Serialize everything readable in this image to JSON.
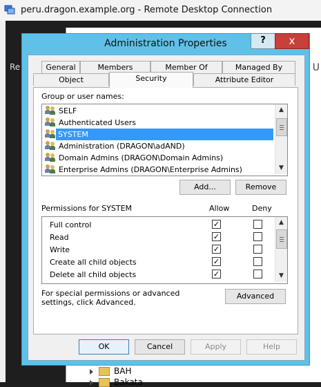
{
  "rdp": {
    "title": "peru.dragon.example.org - Remote Desktop Connection"
  },
  "background": {
    "left_text": "Re",
    "right_text": "y U",
    "tree_items": [
      "BAH",
      "Bakata"
    ]
  },
  "dialog": {
    "title": "Administration Properties",
    "help_label": "?",
    "close_label": "x",
    "tabs_row1": [
      "General",
      "Members",
      "Member Of",
      "Managed By"
    ],
    "tabs_row2": [
      "Object",
      "Security",
      "Attribute Editor"
    ],
    "active_tab": "Security",
    "group_label": "Group or user names:",
    "groups": [
      {
        "name": "SELF",
        "selected": false
      },
      {
        "name": "Authenticated Users",
        "selected": false
      },
      {
        "name": "SYSTEM",
        "selected": true
      },
      {
        "name": "Administration (DRAGON\\adAND)",
        "selected": false
      },
      {
        "name": "Domain Admins (DRAGON\\Domain Admins)",
        "selected": false
      },
      {
        "name": "Enterprise Admins (DRAGON\\Enterprise Admins)",
        "selected": false
      }
    ],
    "add_label": "Add...",
    "remove_label": "Remove",
    "permissions_label": "Permissions for SYSTEM",
    "allow_label": "Allow",
    "deny_label": "Deny",
    "permissions": [
      {
        "name": "Full control",
        "allow": true,
        "deny": false
      },
      {
        "name": "Read",
        "allow": true,
        "deny": false
      },
      {
        "name": "Write",
        "allow": true,
        "deny": false
      },
      {
        "name": "Create all child objects",
        "allow": true,
        "deny": false
      },
      {
        "name": "Delete all child objects",
        "allow": true,
        "deny": false
      }
    ],
    "advanced_text": "For special permissions or advanced settings, click Advanced.",
    "advanced_label": "Advanced",
    "ok_label": "OK",
    "cancel_label": "Cancel",
    "apply_label": "Apply",
    "help_button_label": "Help"
  }
}
